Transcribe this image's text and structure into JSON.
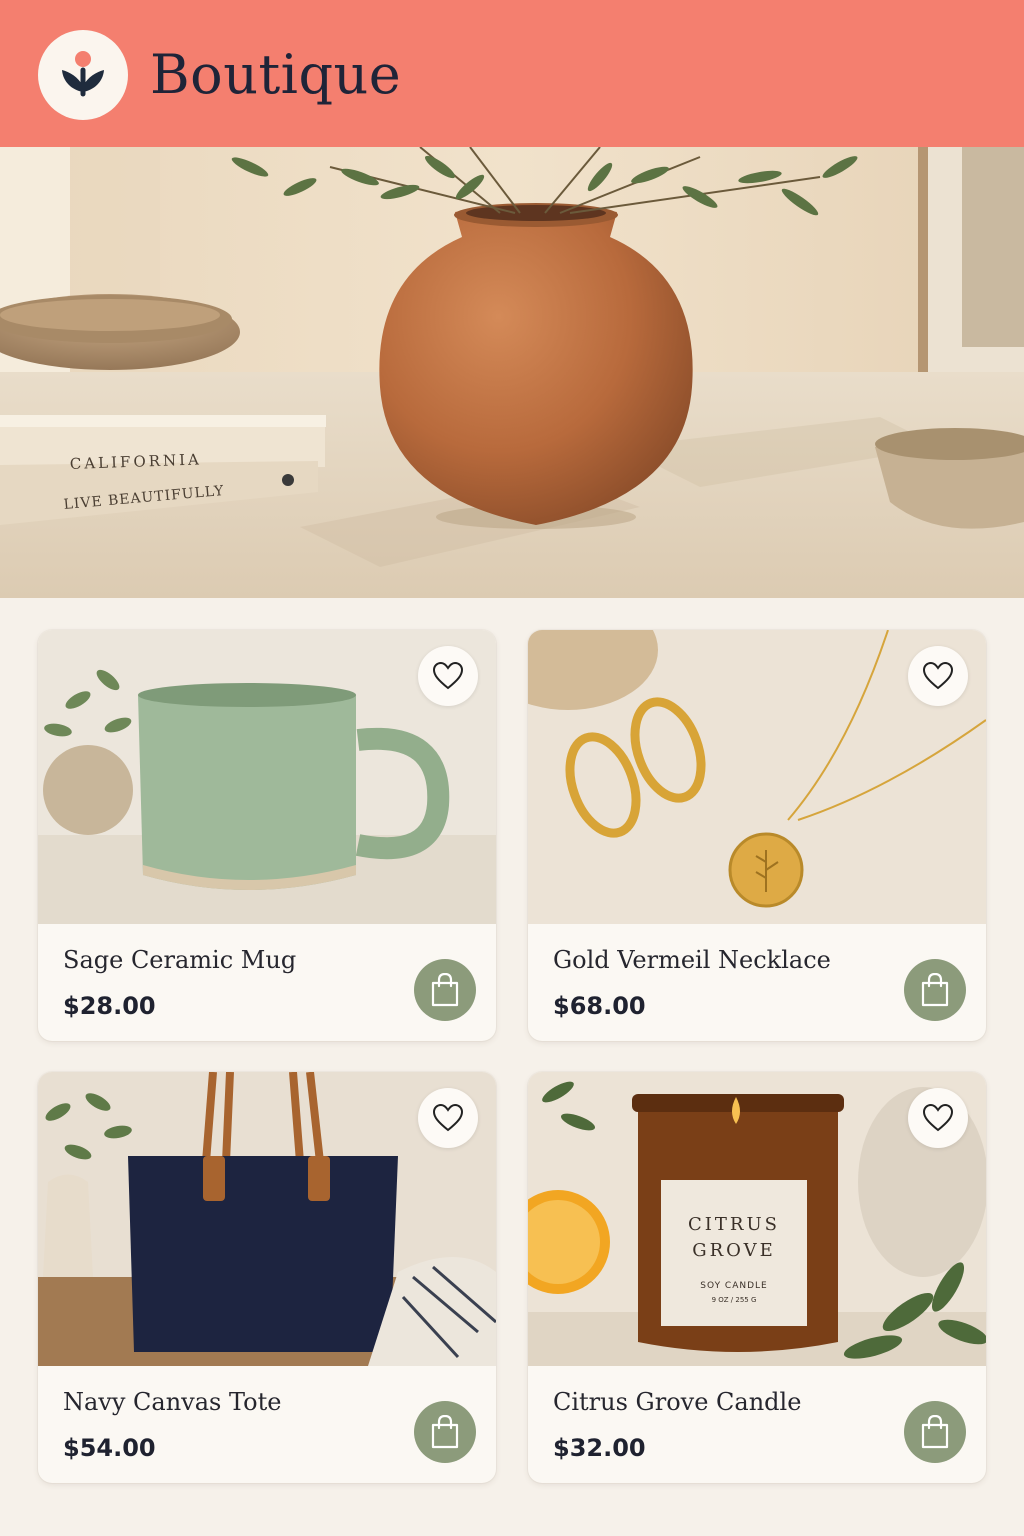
{
  "app": {
    "title": "Boutique"
  },
  "hero": {
    "book_top_title": "CALIFORNIA",
    "book_bottom_title": "LIVE BEAUTIFULLY"
  },
  "products": [
    {
      "name": "Sage Ceramic Mug",
      "price": "$28.00"
    },
    {
      "name": "Gold Vermeil Necklace",
      "price": "$68.00"
    },
    {
      "name": "Navy Canvas Tote",
      "price": "$54.00"
    },
    {
      "name": "Citrus Grove Candle",
      "price": "$32.00"
    }
  ],
  "candle_label": {
    "line1": "CITRUS",
    "line2": "GROVE",
    "line3": "SOY CANDLE",
    "line4": "9 OZ / 255 G"
  },
  "icons": {
    "logo": "tulip-icon",
    "favorite": "heart-icon",
    "cart": "shopping-bag-icon"
  },
  "colors": {
    "header": "#f47f6f",
    "cart_button": "#8c9b7b",
    "title_text": "#1f2438",
    "background": "#f6f1ea"
  }
}
